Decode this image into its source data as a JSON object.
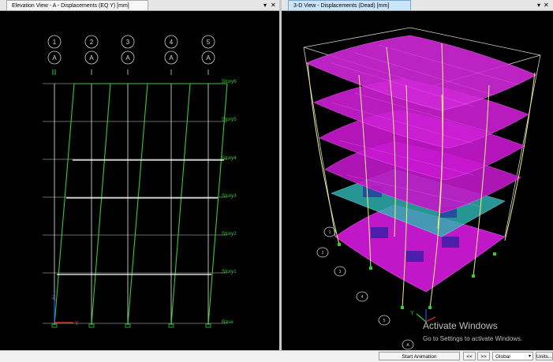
{
  "left_pane": {
    "tab_title": "Elevation View - A  - Displacements (EQ Y)  [mm]",
    "pin_glyph": "▾",
    "close_glyph": "✕",
    "grid_numbers": [
      "1",
      "2",
      "3",
      "4",
      "5"
    ],
    "grid_letter": "A",
    "story_labels": [
      "Story6",
      "Story5",
      "Story4",
      "Story3",
      "Story2",
      "Story1",
      "Base"
    ],
    "axis_y_label": "Y",
    "axis_z_label": "Z"
  },
  "right_pane": {
    "tab_title": "3-D View  - Displacements (Dead)  [mm]",
    "pin_glyph": "▾",
    "close_glyph": "✕",
    "grid_bubbles": [
      "1",
      "2",
      "3",
      "4",
      "5",
      "A"
    ],
    "axis_y_label": "Y"
  },
  "status_bar": {
    "start_animation": "Start Animation",
    "prev": "<<",
    "next": ">>",
    "coord_system": "Global",
    "units": "Units..."
  },
  "watermark": {
    "line1": "Activate Windows",
    "line2": "Go to Settings to activate Windows."
  },
  "colors": {
    "background": "#000000",
    "frame_deformed": "#33cc33",
    "frame_undeformed": "#ffffff",
    "story_label": "#33cc33",
    "slab_magenta": "#e020e0",
    "slab_cyan": "#30b0b0",
    "column_yellow": "#f0f07a"
  }
}
